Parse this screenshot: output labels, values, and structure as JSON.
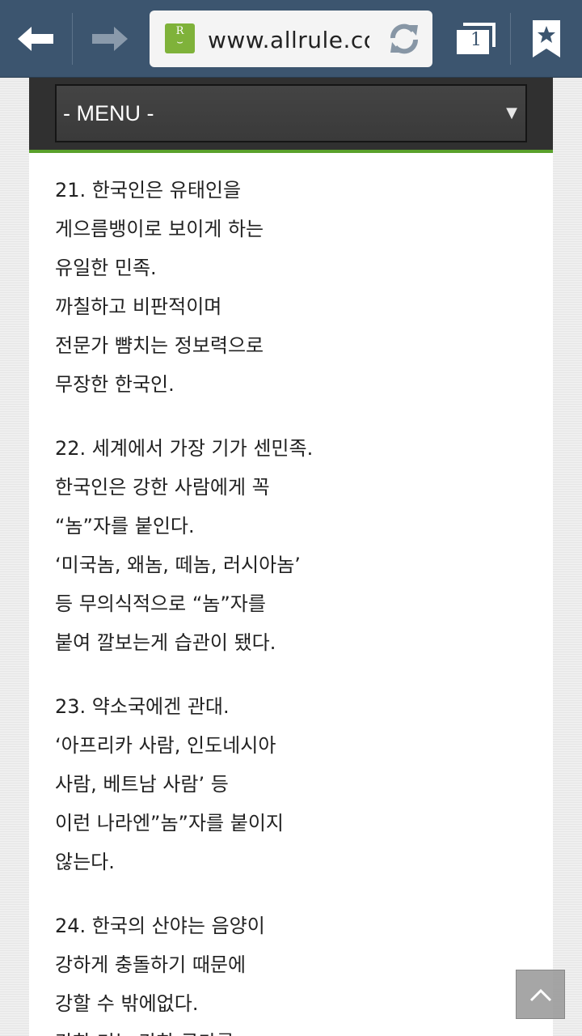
{
  "browser": {
    "url": "www.allrule.co",
    "tab_count": "1",
    "favicon_letter": "R",
    "icons": {
      "back": "back-arrow-icon",
      "forward": "forward-arrow-icon",
      "reload": "reload-icon",
      "tabs": "tabs-icon",
      "bookmark": "bookmark-star-icon"
    }
  },
  "menu": {
    "label": "- MENU -",
    "arrow": "▼"
  },
  "article": {
    "paragraphs": [
      [
        "21. 한국인은 유태인을",
        "게으름뱅이로 보이게 하는",
        "유일한 민족.",
        "까칠하고 비판적이며",
        "전문가 뺨치는 정보력으로",
        "무장한 한국인."
      ],
      [
        "22. 세계에서 가장 기가 센민족.",
        "한국인은 강한 사람에게 꼭",
        "“놈”자를 붙인다.",
        "‘미국놈, 왜놈, 떼놈, 러시아놈’",
        "등 무의식적으로 “놈”자를",
        "붙여 깔보는게 습관이 됐다."
      ],
      [
        "23. 약소국에겐 관대.",
        "‘아프리카 사람, 인도네시아",
        "사람, 베트남 사람’ 등",
        "이런 나라엔”놈”자를 붙이지",
        "않는다."
      ],
      [
        "24. 한국의 산야는 음양이",
        "강하게 충돌하기 때문에",
        "강할 수 밖에없다.",
        "강한 기는 강한 국가를"
      ]
    ]
  },
  "scroll_top": {
    "icon": "chevron-up-icon"
  },
  "colors": {
    "toolbar": "#3c556f",
    "menu_band": "#303030",
    "accent_green": "#5aa12b",
    "favicon_green": "#7fb23a"
  }
}
